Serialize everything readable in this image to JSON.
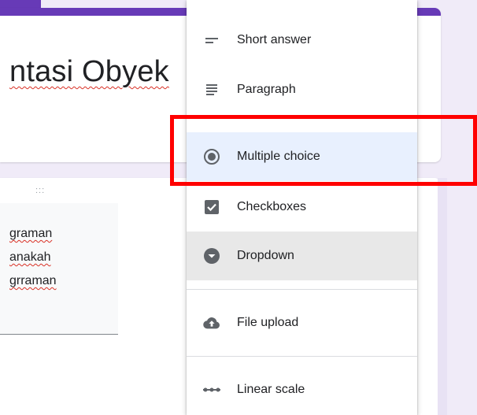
{
  "form": {
    "title": "ntasi Obyek",
    "drag_handle": ":::",
    "answer_lines": [
      "graman",
      "anakah",
      "grraman"
    ]
  },
  "menu": {
    "items": [
      {
        "label": "Short answer",
        "icon": "short-answer-icon"
      },
      {
        "label": "Paragraph",
        "icon": "paragraph-icon"
      },
      {
        "label": "Multiple choice",
        "icon": "radio-icon",
        "selected": true
      },
      {
        "label": "Checkboxes",
        "icon": "checkbox-icon"
      },
      {
        "label": "Dropdown",
        "icon": "dropdown-icon"
      },
      {
        "label": "File upload",
        "icon": "cloud-upload-icon"
      },
      {
        "label": "Linear scale",
        "icon": "linear-scale-icon"
      }
    ]
  },
  "colors": {
    "accent": "#673ab7",
    "selected_bg": "#e8f0fe",
    "highlight": "#ff0000",
    "icon": "#5f6368"
  }
}
